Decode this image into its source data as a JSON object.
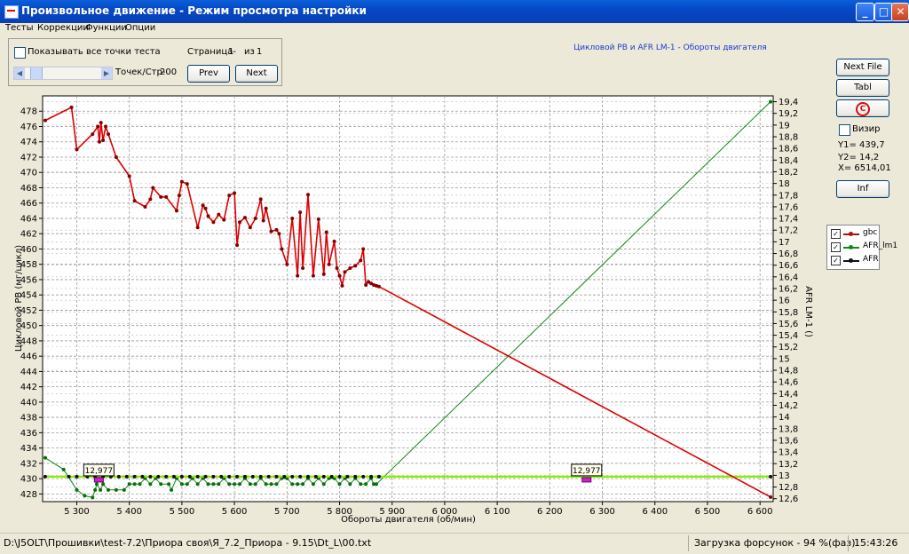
{
  "window": {
    "title": "Произвольное движение - Режим просмотра настройки",
    "buttons": [
      "_",
      "□",
      "✕"
    ]
  },
  "menu": [
    "Тесты",
    "Коррекции",
    "Функции",
    "Опции"
  ],
  "panel": {
    "show_all_label": "Показывать все точки теста",
    "show_all_checked": false,
    "page_label": "Страница-",
    "page_value": "1",
    "of_label": "из",
    "of_value": "1",
    "points_label": "Точек/Стр-",
    "points_value": "200",
    "prev_label": "Prev",
    "next_label": "Next"
  },
  "right_panel": {
    "next_file_label": "Next File",
    "tabl_label": "Tabl",
    "refresh_glyph": "C",
    "vizir_label": "Визир",
    "vizir_checked": false,
    "y1": "Y1= 439,7",
    "y2": "Y2= 14,2",
    "x": "X= 6514,01",
    "inf_label": "Inf"
  },
  "legend": [
    {
      "label": "gbc",
      "color": "#aa1111",
      "checked": true
    },
    {
      "label": "AFR_lm1",
      "color": "#118811",
      "checked": true
    },
    {
      "label": "AFR",
      "color": "#111111",
      "checked": true
    }
  ],
  "chart_data": {
    "type": "line",
    "title": "Цикловой РВ и AFR LM-1 - Обороты двигателя",
    "xlabel": "Обороты двигателя (об/мин)",
    "ylabel": "Цикловой РВ (мг/цикл)",
    "y2label": "AFR LM-1 ()",
    "xlim": [
      5235,
      6625
    ],
    "ylim": [
      427,
      480
    ],
    "y2lim": [
      12.55,
      19.5
    ],
    "x_ticks": [
      5300,
      5400,
      5500,
      5600,
      5700,
      5800,
      5900,
      6000,
      6100,
      6200,
      6300,
      6400,
      6500,
      6600
    ],
    "x_tick_labels": [
      "5 300",
      "5 400",
      "5 500",
      "5 600",
      "5 700",
      "5 800",
      "5 900",
      "6 000",
      "6 100",
      "6 200",
      "6 300",
      "6 400",
      "6 500",
      "6 600"
    ],
    "y_ticks": [
      428,
      430,
      432,
      434,
      436,
      438,
      440,
      442,
      444,
      446,
      448,
      450,
      452,
      454,
      456,
      458,
      460,
      462,
      464,
      466,
      468,
      470,
      472,
      474,
      476,
      478
    ],
    "y2_ticks": [
      "12,6",
      "12,8",
      "13",
      "13,2",
      "13,4",
      "13,6",
      "13,8",
      "14",
      "14,2",
      "14,4",
      "14,6",
      "14,8",
      "15",
      "15,2",
      "15,4",
      "15,6",
      "15,8",
      "16",
      "16,2",
      "16,4",
      "16,6",
      "16,8",
      "17",
      "17,2",
      "17,4",
      "17,6",
      "17,8",
      "18",
      "18,2",
      "18,4",
      "18,6",
      "18,8",
      "19",
      "19,2",
      "19,4"
    ],
    "grid": true,
    "series": [
      {
        "name": "gbc",
        "axis": "left",
        "color": "#dd0000",
        "marker": "#880000",
        "x": [
          5240,
          5290,
          5300,
          5330,
          5340,
          5343,
          5346,
          5350,
          5355,
          5360,
          5375,
          5400,
          5410,
          5430,
          5440,
          5445,
          5460,
          5470,
          5490,
          5495,
          5500,
          5510,
          5530,
          5540,
          5545,
          5550,
          5560,
          5570,
          5580,
          5590,
          5600,
          5605,
          5610,
          5620,
          5630,
          5640,
          5650,
          5655,
          5660,
          5670,
          5680,
          5685,
          5690,
          5700,
          5710,
          5720,
          5725,
          5730,
          5740,
          5750,
          5760,
          5770,
          5775,
          5780,
          5790,
          5795,
          5800,
          5805,
          5810,
          5820,
          5830,
          5840,
          5845,
          5850,
          5855,
          5860,
          5865,
          5870,
          5875,
          6620
        ],
        "y": [
          476.8,
          478.5,
          473.0,
          475.0,
          476.0,
          474.0,
          476.5,
          474.2,
          476.0,
          475.0,
          472.0,
          469.5,
          466.3,
          465.5,
          466.5,
          468.0,
          466.8,
          466.8,
          465.0,
          467.0,
          468.8,
          468.5,
          462.8,
          465.7,
          465.3,
          464.3,
          463.5,
          464.5,
          463.8,
          467.0,
          467.3,
          460.5,
          463.5,
          464.1,
          462.8,
          464.0,
          466.5,
          463.7,
          465.3,
          462.3,
          462.5,
          462.0,
          460.0,
          458.0,
          464.0,
          456.5,
          464.8,
          457.5,
          467.1,
          456.5,
          463.9,
          456.7,
          462.2,
          458.0,
          461.0,
          457.5,
          456.5,
          455.2,
          457.0,
          457.5,
          457.8,
          458.5,
          460.0,
          455.3,
          455.7,
          455.5,
          455.3,
          455.2,
          455.1,
          427.6
        ]
      },
      {
        "name": "AFR_lm1",
        "axis": "right",
        "color": "#118811",
        "marker": "#0a6d0a",
        "x": [
          5240,
          5275,
          5300,
          5315,
          5330,
          5335,
          5338,
          5345,
          5350,
          5360,
          5375,
          5390,
          5400,
          5410,
          5420,
          5430,
          5440,
          5450,
          5460,
          5475,
          5480,
          5490,
          5500,
          5510,
          5520,
          5530,
          5540,
          5550,
          5560,
          5570,
          5580,
          5590,
          5600,
          5610,
          5620,
          5630,
          5640,
          5650,
          5660,
          5670,
          5680,
          5690,
          5700,
          5710,
          5720,
          5730,
          5740,
          5750,
          5760,
          5770,
          5780,
          5790,
          5800,
          5810,
          5820,
          5830,
          5840,
          5850,
          5860,
          5865,
          5870,
          6620
        ],
        "y": [
          13.3,
          13.1,
          12.75,
          12.65,
          12.62,
          12.75,
          12.85,
          12.75,
          12.85,
          12.75,
          12.75,
          12.75,
          12.85,
          12.85,
          12.85,
          12.95,
          12.85,
          12.95,
          12.85,
          12.85,
          12.75,
          12.95,
          12.85,
          12.85,
          12.95,
          12.85,
          12.95,
          12.85,
          12.85,
          12.85,
          12.95,
          12.85,
          12.85,
          12.85,
          12.95,
          12.85,
          12.85,
          12.95,
          12.85,
          12.85,
          12.85,
          12.95,
          12.95,
          12.85,
          12.85,
          12.85,
          12.95,
          12.85,
          12.95,
          12.85,
          12.95,
          12.95,
          12.85,
          12.95,
          12.85,
          12.95,
          12.85,
          12.85,
          12.95,
          12.85,
          12.85,
          19.4
        ]
      },
      {
        "name": "AFR",
        "axis": "right",
        "color": "#88ee00",
        "marker": "#111111",
        "constant_y": 12.977,
        "x": [
          5240,
          5285,
          5300,
          5320,
          5335,
          5350,
          5365,
          5380,
          5395,
          5410,
          5425,
          5440,
          5455,
          5470,
          5485,
          5500,
          5515,
          5530,
          5545,
          5560,
          5575,
          5590,
          5605,
          5620,
          5635,
          5650,
          5665,
          5680,
          5695,
          5710,
          5725,
          5740,
          5755,
          5770,
          5785,
          5800,
          5815,
          5830,
          5845,
          5860,
          5875,
          6620
        ],
        "y": [
          12.977,
          12.977,
          12.977,
          12.977,
          12.977,
          12.977,
          12.977,
          12.977,
          12.977,
          12.977,
          12.977,
          12.977,
          12.977,
          12.977,
          12.977,
          12.977,
          12.977,
          12.977,
          12.977,
          12.977,
          12.977,
          12.977,
          12.977,
          12.977,
          12.977,
          12.977,
          12.977,
          12.977,
          12.977,
          12.977,
          12.977,
          12.977,
          12.977,
          12.977,
          12.977,
          12.977,
          12.977,
          12.977,
          12.977,
          12.977,
          12.977,
          12.977
        ]
      }
    ],
    "annotations": [
      {
        "text": "12,977",
        "x": 5342,
        "y2": 12.977
      },
      {
        "text": "12,977",
        "x": 6270,
        "y2": 12.977
      }
    ]
  },
  "status": {
    "path": "D:\\J5OLT\\Прошивки\\test-7.2\\Приора своя\\Я_7.2_Приора - 9.15\\Dt_L\\00.txt",
    "injectors": "Загрузка форсунок - 94 %(фаз)",
    "time": "15:43:26"
  }
}
